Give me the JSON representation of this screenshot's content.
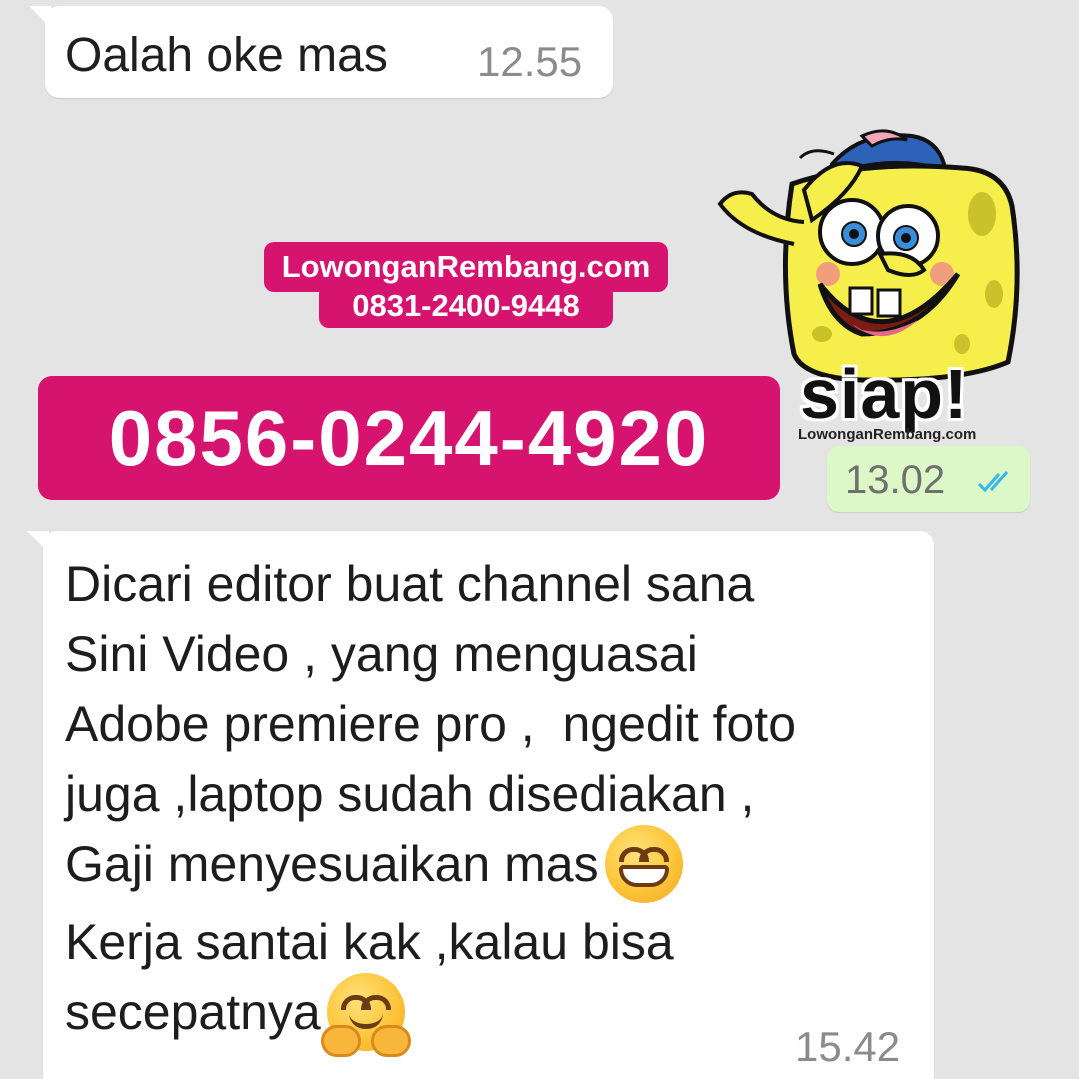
{
  "messages": [
    {
      "direction": "incoming",
      "text": "Oalah oke mas",
      "time": "12.55"
    },
    {
      "direction": "outgoing",
      "type": "sticker",
      "sticker_text": "siap!",
      "sticker_caption": "LowonganRembang.com",
      "time": "13.02",
      "status_icon": "double-check-read-icon",
      "status_color": "#34b7f1"
    },
    {
      "direction": "incoming",
      "lines": [
        "Dicari editor buat channel sana",
        "Sini Video , yang menguasai",
        "Adobe premiere pro ,  ngedit foto",
        "juga ,laptop sudah disediakan ,",
        "Gaji menyesuaikan mas",
        "Kerja santai kak ,kalau bisa",
        "secepatnya"
      ],
      "emojis": [
        "grinning-face-icon",
        "hugging-face-icon"
      ],
      "time": "15.42"
    }
  ],
  "watermark": {
    "site": "LowonganRembang.com",
    "contact": "0831-2400-9448",
    "phone": "0856-0244-4920",
    "color": "#d6136e"
  },
  "colors": {
    "background": "#e4e4e4",
    "incoming_bubble": "#ffffff",
    "outgoing_bubble": "#dcf8c6"
  }
}
